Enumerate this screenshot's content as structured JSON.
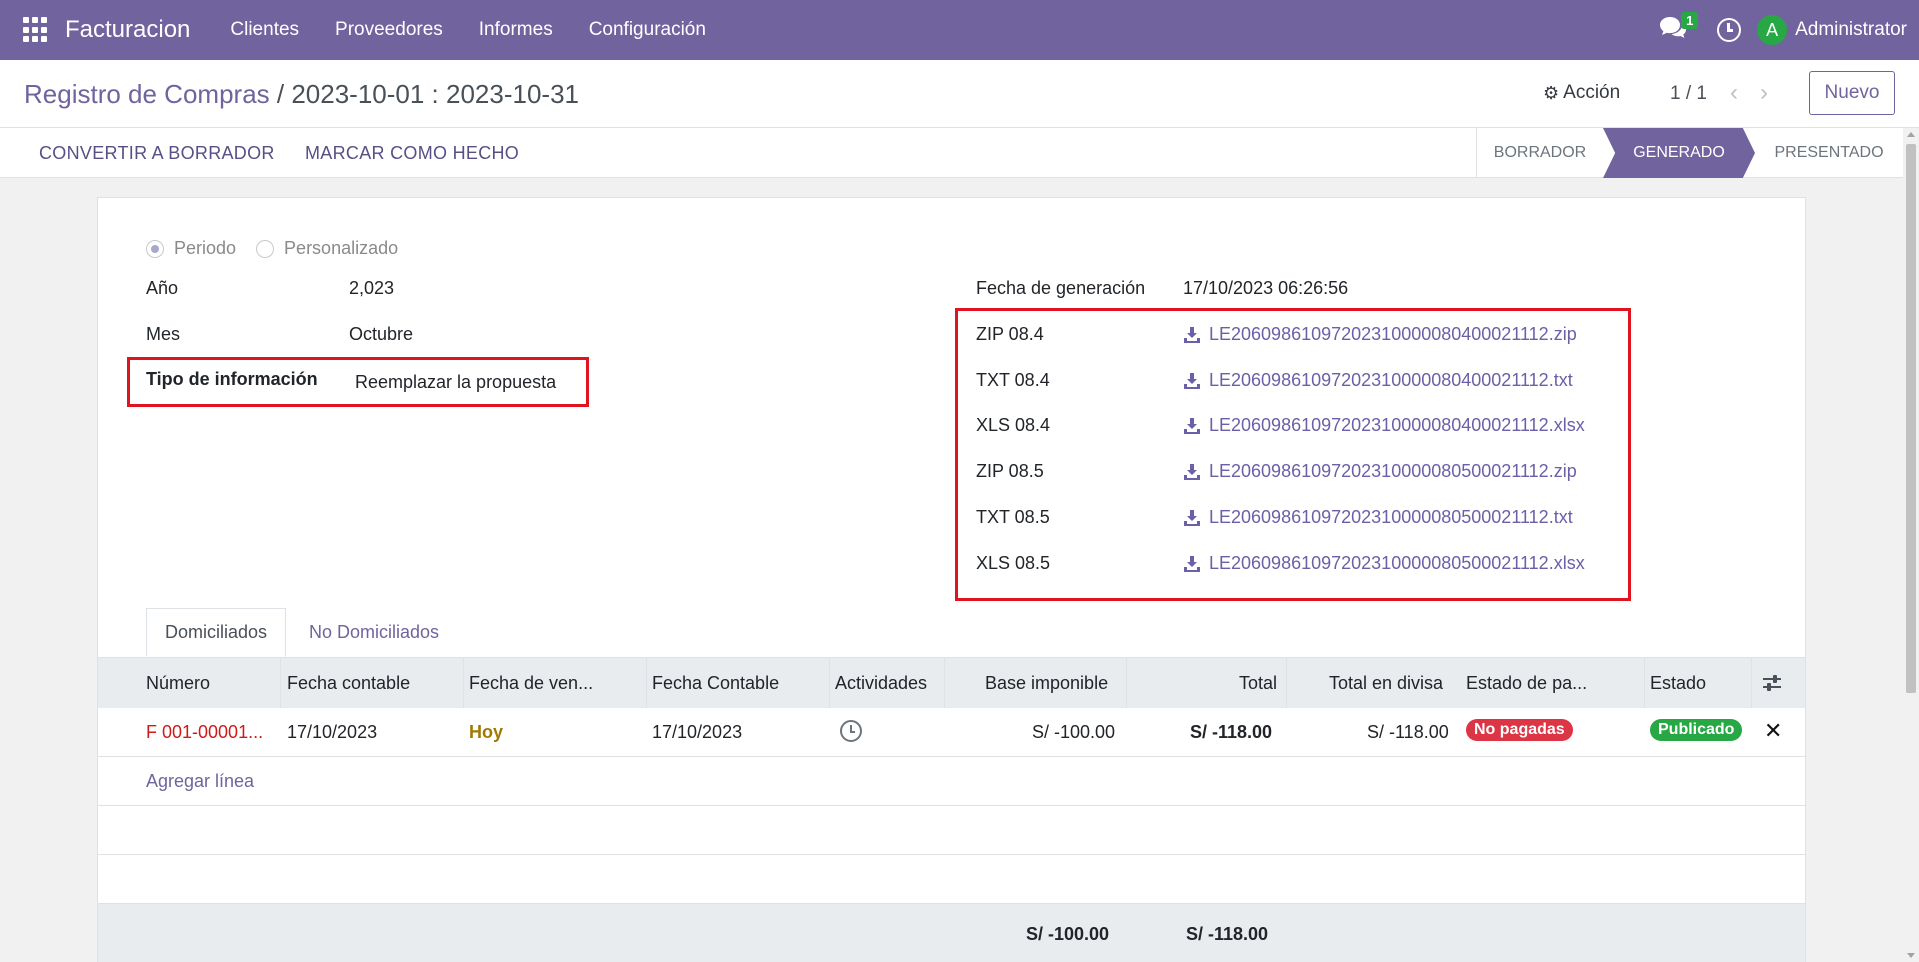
{
  "navbar": {
    "brand": "Facturacion",
    "menu": [
      "Clientes",
      "Proveedores",
      "Informes",
      "Configuración"
    ],
    "chat_count": "1",
    "user_initial": "A",
    "user_name": "Administrator"
  },
  "control": {
    "breadcrumb_parent": "Registro de Compras",
    "breadcrumb_current": "/ 2023-10-01 : 2023-10-31",
    "action_label": "Acción",
    "pager": "1 / 1",
    "new_label": "Nuevo"
  },
  "header": {
    "buttons": [
      "CONVERTIR A BORRADOR",
      "MARCAR COMO HECHO"
    ],
    "stages": [
      "BORRADOR",
      "GENERADO",
      "PRESENTADO"
    ],
    "active_stage": "GENERADO"
  },
  "form": {
    "radio_options": [
      "Periodo",
      "Personalizado"
    ],
    "radio_selected": "Periodo",
    "anio_label": "Año",
    "anio_value": "2,023",
    "mes_label": "Mes",
    "mes_value": "Octubre",
    "tipo_label": "Tipo de información",
    "tipo_value": "Reemplazar la propuesta",
    "fecha_gen_label": "Fecha de generación",
    "fecha_gen_value": "17/10/2023 06:26:56",
    "files": [
      {
        "label": "ZIP 08.4",
        "file": "LE20609861097202310000080400021112.zip"
      },
      {
        "label": "TXT 08.4",
        "file": "LE20609861097202310000080400021112.txt"
      },
      {
        "label": "XLS 08.4",
        "file": "LE20609861097202310000080400021112.xlsx"
      },
      {
        "label": "ZIP 08.5",
        "file": "LE20609861097202310000080500021112.zip"
      },
      {
        "label": "TXT 08.5",
        "file": "LE20609861097202310000080500021112.txt"
      },
      {
        "label": "XLS 08.5",
        "file": "LE20609861097202310000080500021112.xlsx"
      }
    ]
  },
  "tabs": [
    "Domiciliados",
    "No Domiciliados"
  ],
  "table": {
    "headers": [
      "Número",
      "Fecha contable",
      "Fecha de ven...",
      "Fecha Contable",
      "Actividades",
      "Base imponible",
      "Total",
      "Total en divisa",
      "Estado de pa...",
      "Estado"
    ],
    "row": {
      "numero": "F 001-00001...",
      "fecha_contable": "17/10/2023",
      "fecha_venc": "Hoy",
      "fecha_contable2": "17/10/2023",
      "base": "S/ -100.00",
      "total": "S/ -118.00",
      "total_divisa": "S/ -118.00",
      "estado_pago": "No pagadas",
      "estado": "Publicado"
    },
    "add_line": "Agregar línea",
    "footer_base": "S/ -100.00",
    "footer_total": "S/ -118.00"
  },
  "colors": {
    "navbar": "#71639e",
    "danger": "#dc3545",
    "success": "#28a745",
    "highlight_box": "#e0141e"
  }
}
